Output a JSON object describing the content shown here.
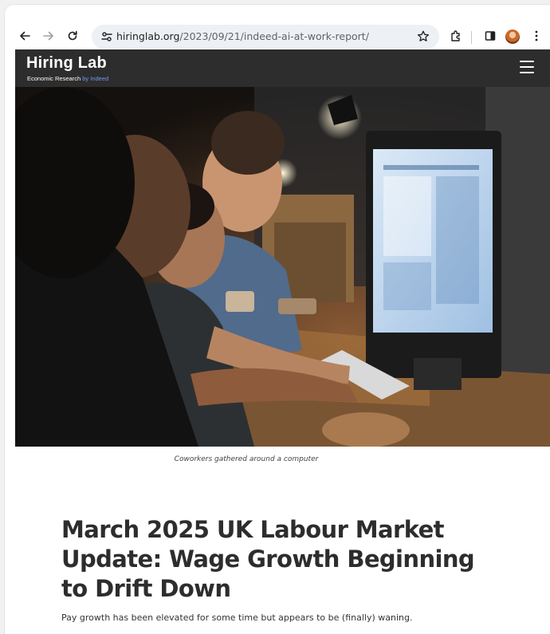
{
  "browser": {
    "url_host": "hiringlab.org",
    "url_path": "/2023/09/21/indeed-ai-at-work-report/"
  },
  "site": {
    "logo_title": "Hiring Lab",
    "logo_sub": "Economic Research",
    "logo_brand": "by Indeed"
  },
  "hero": {
    "caption": "Coworkers gathered around a computer"
  },
  "article": {
    "title": "March 2025 UK Labour Market Update: Wage Growth Beginning to Drift Down",
    "dek": "Pay growth has been elevated for some time but appears to be (finally) waning."
  },
  "icons": [
    "back-arrow-icon",
    "forward-arrow-icon",
    "reload-icon",
    "site-settings-icon",
    "bookmark-star-icon",
    "extensions-icon",
    "side-panel-icon",
    "profile-avatar",
    "more-menu-icon",
    "hamburger-menu-icon"
  ]
}
